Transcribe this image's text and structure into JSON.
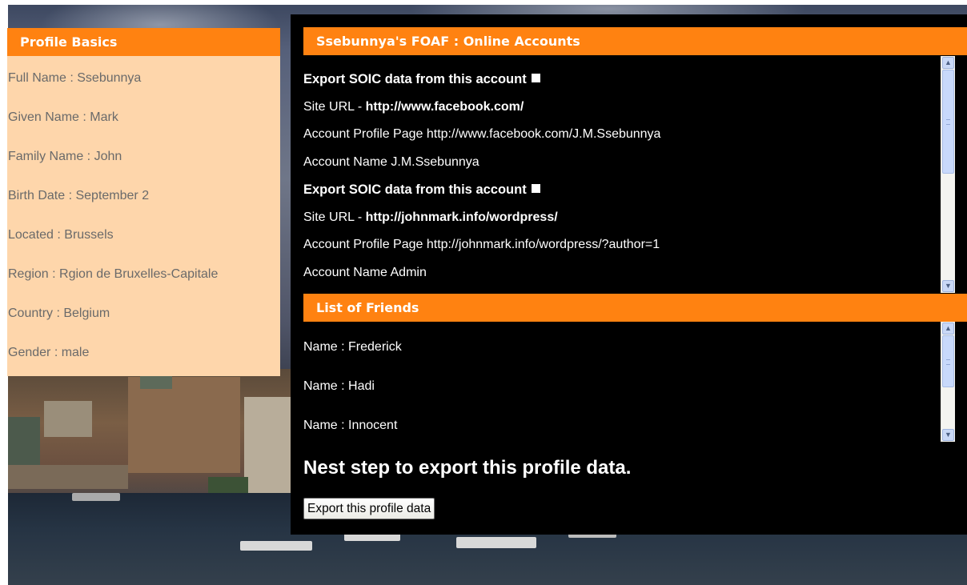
{
  "profile": {
    "title": "Profile Basics",
    "fields": [
      "Full Name : Ssebunnya",
      "Given Name : Mark",
      "Family Name : John",
      "Birth Date : September 2",
      "Located : Brussels",
      "Region : Rgion de Bruxelles-Capitale",
      "Country : Belgium",
      "Gender : male"
    ]
  },
  "accounts": {
    "title": "Ssebunnya's FOAF : Online Accounts",
    "export_label": "Export SOIC data from this account",
    "site_url_prefix": "Site URL - ",
    "items": [
      {
        "site_url": "http://www.facebook.com/",
        "profile_page": "Account Profile Page http://www.facebook.com/J.M.Ssebunnya",
        "account_name": "Account Name J.M.Ssebunnya"
      },
      {
        "site_url": "http://johnmark.info/wordpress/",
        "profile_page": "Account Profile Page http://johnmark.info/wordpress/?author=1",
        "account_name": "Account Name Admin"
      }
    ]
  },
  "friends": {
    "title": "List of Friends",
    "items": [
      "Name : Frederick",
      "Name : Hadi",
      "Name : Innocent"
    ]
  },
  "next_step": {
    "heading": "Nest step to export this profile data.",
    "button_label": "Export this profile data"
  }
}
